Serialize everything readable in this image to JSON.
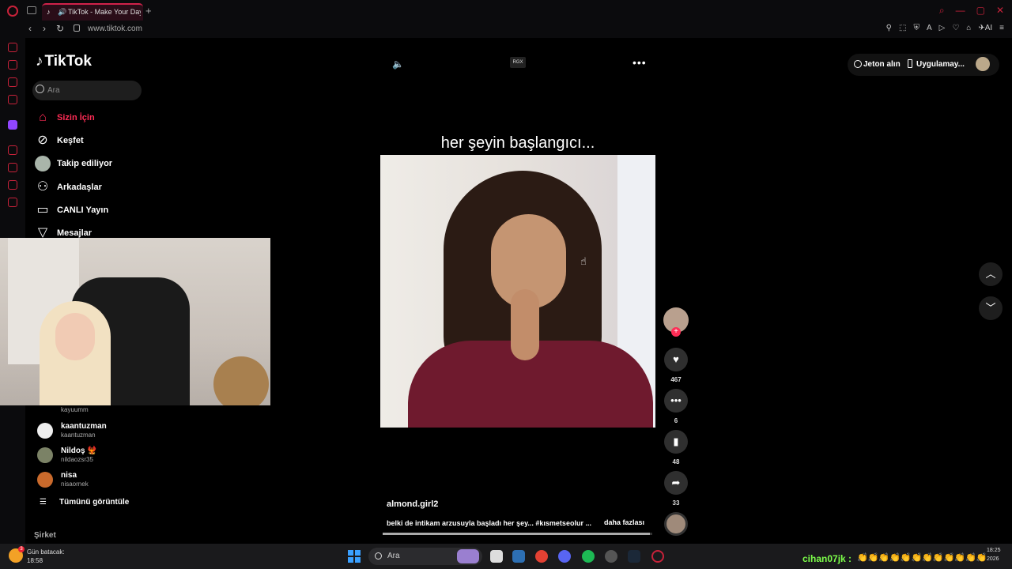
{
  "browser": {
    "tab_title": "TikTok - Make Your Day",
    "url": "www.tiktok.com",
    "accent": "#c8223a"
  },
  "tiktok": {
    "logo": "TikTok",
    "search_placeholder": "Ara",
    "nav": [
      {
        "label": "Sizin İçin",
        "icon": "home-icon",
        "active": true
      },
      {
        "label": "Keşfet",
        "icon": "compass-icon",
        "active": false
      },
      {
        "label": "Takip ediliyor",
        "icon": "avatar",
        "active": false
      },
      {
        "label": "Arkadaşlar",
        "icon": "friends-icon",
        "active": false
      },
      {
        "label": "CANLI Yayın",
        "icon": "live-tv-icon",
        "active": false
      },
      {
        "label": "Mesajlar",
        "icon": "messages-icon",
        "active": false
      }
    ],
    "following": {
      "partial_handle": "kayuumm",
      "accounts": [
        {
          "name": "kaantuzman",
          "handle": "kaantuzman"
        },
        {
          "name": "Nildoş 🐦‍🔥",
          "handle": "nildaozsr35"
        },
        {
          "name": "nisa",
          "handle": "nisaornek"
        }
      ],
      "view_all": "Tümünü görüntüle"
    },
    "company": "Şirket",
    "topbar": {
      "coins": "Jeton alın",
      "app": "Uygulamay..."
    },
    "rgx_badge": "RGX",
    "video": {
      "caption_overlay": "her şeyin başlangıcı...",
      "author": "almond.girl2",
      "description": "belki de intikam arzusuyla başladı her şey... #kısmetseolur ...",
      "more_label": "daha fazlası",
      "progress": 0.99
    },
    "actions": {
      "likes": "467",
      "comments": "6",
      "saves": "48",
      "shares": "33"
    },
    "brand_color": "#fe2c55"
  },
  "taskbar": {
    "weather_label": "Gün batacak:",
    "weather_time": "18:58",
    "weather_badge": "3",
    "search_label": "Ara",
    "chat_user": "cihan07jk :",
    "chat_emojis": "👏👏👏👏👏👏👏👏👏👏👏👏",
    "clock_time": "18:25",
    "clock_date": "2026"
  }
}
